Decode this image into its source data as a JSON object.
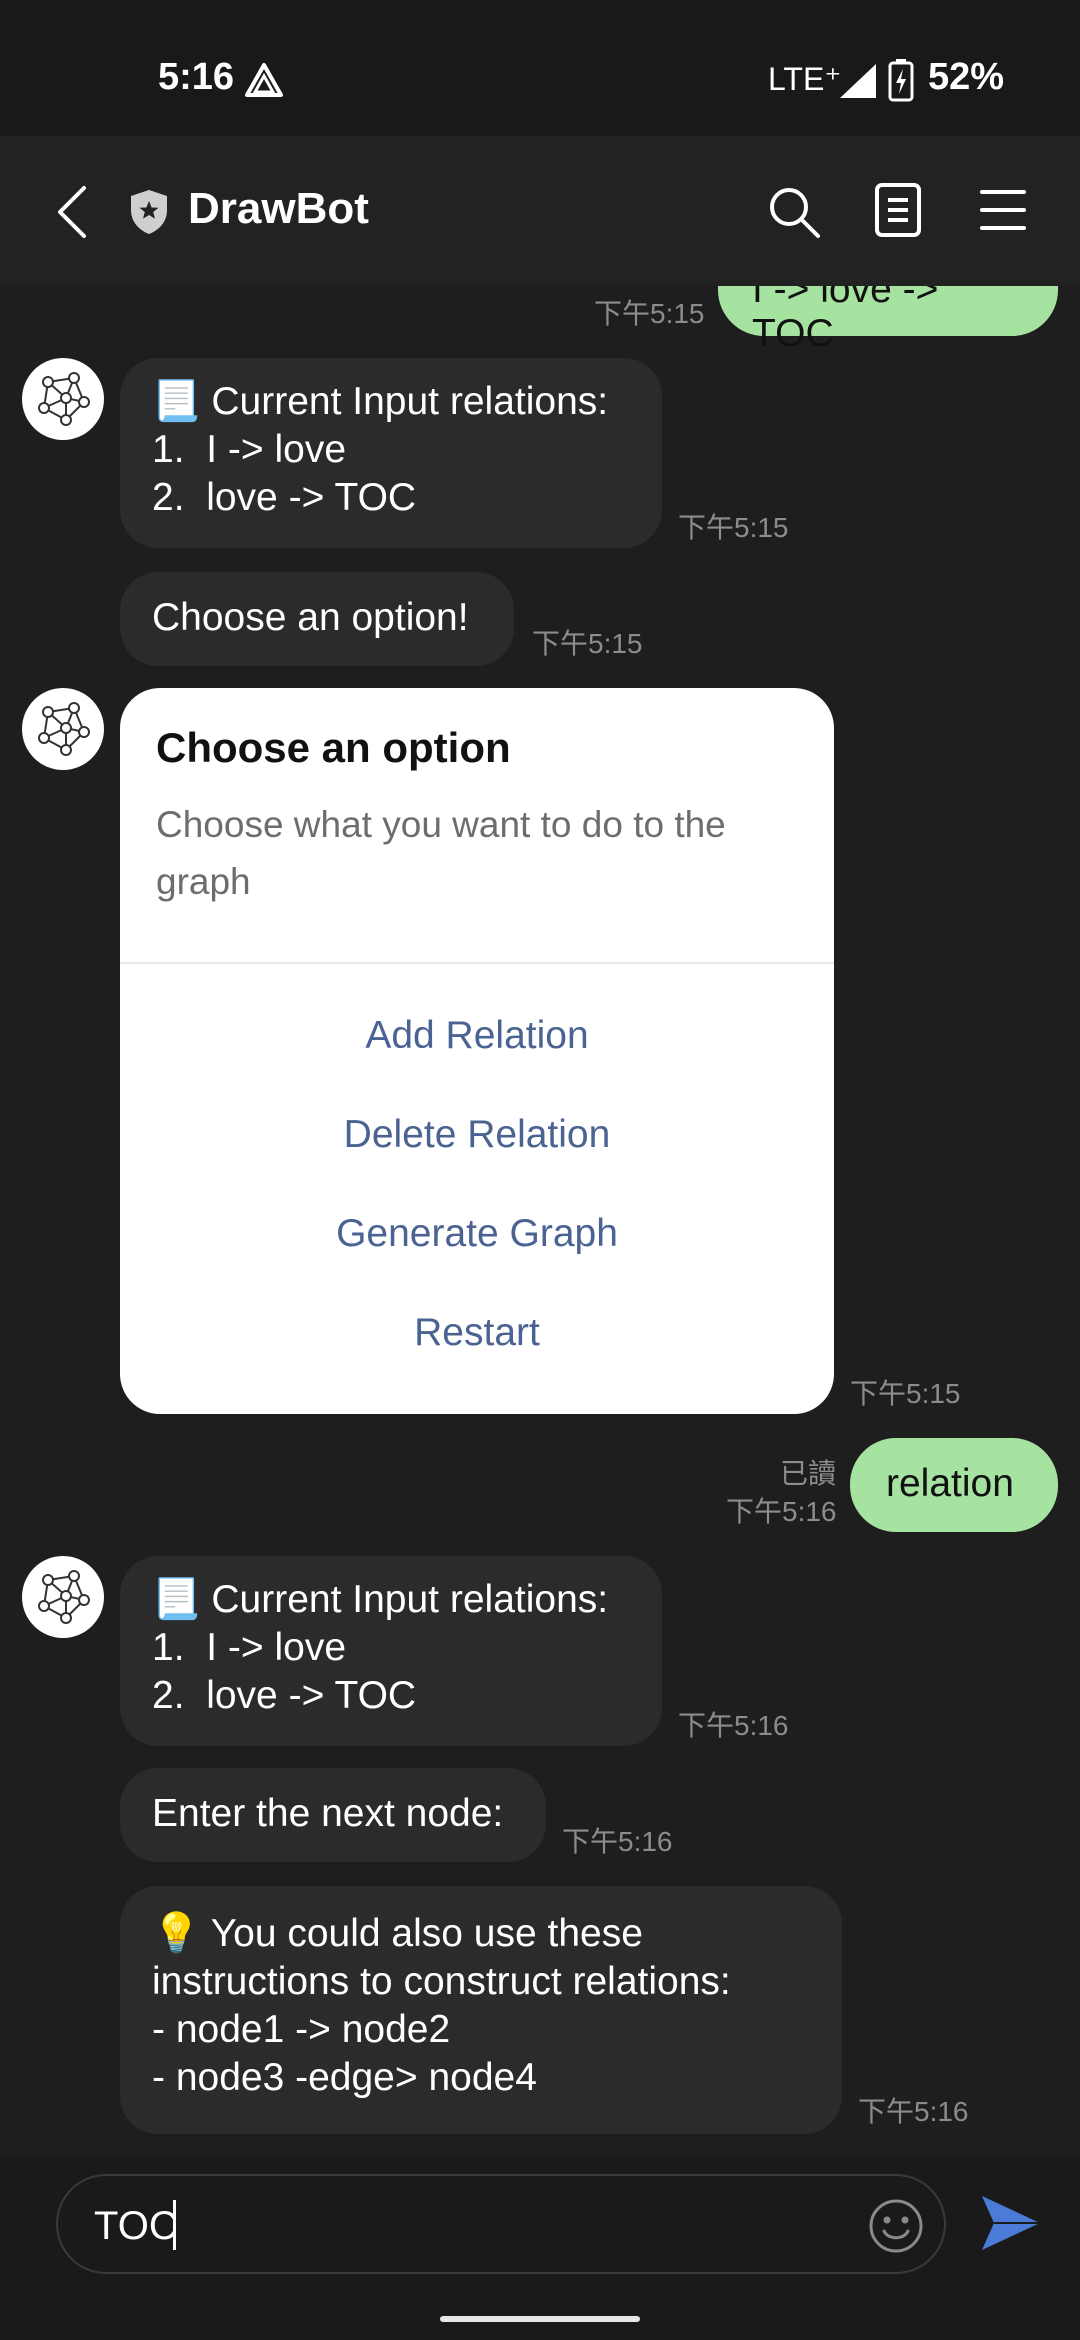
{
  "status_bar": {
    "time": "5:16",
    "network": "LTE⁺",
    "battery": "52%"
  },
  "header": {
    "title": "DrawBot"
  },
  "messages": {
    "top_out": {
      "text": "I -> love -> TOC",
      "time": "下午5:15"
    },
    "relations_1": {
      "title": "📃 Current Input relations:",
      "item1": "1.  I -> love",
      "item2": "2.  love -> TOC",
      "time": "下午5:15"
    },
    "choose_1": {
      "text": "Choose an option!",
      "time": "下午5:15"
    },
    "card": {
      "title": "Choose an option",
      "description": "Choose what you want to do to the graph",
      "options": [
        "Add Relation",
        "Delete Relation",
        "Generate Graph",
        "Restart"
      ],
      "time": "下午5:15"
    },
    "relation_out": {
      "text": "relation",
      "read": "已讀",
      "time": "下午5:16"
    },
    "relations_2": {
      "title": "📃 Current Input relations:",
      "item1": "1.  I -> love",
      "item2": "2.  love -> TOC",
      "time": "下午5:16"
    },
    "enter_node": {
      "text": "Enter the next node:",
      "time": "下午5:16"
    },
    "tip": {
      "line1": "💡 You could also use these",
      "line2": "instructions to construct relations:",
      "line3": "- node1 -> node2",
      "line4": "- node3 -edge> node4",
      "time": "下午5:16"
    }
  },
  "input": {
    "value": "TOC"
  },
  "colors": {
    "accent_send": "#4a7bd6",
    "out_bubble": "#a6e3a1",
    "option_link": "#4b6392"
  }
}
